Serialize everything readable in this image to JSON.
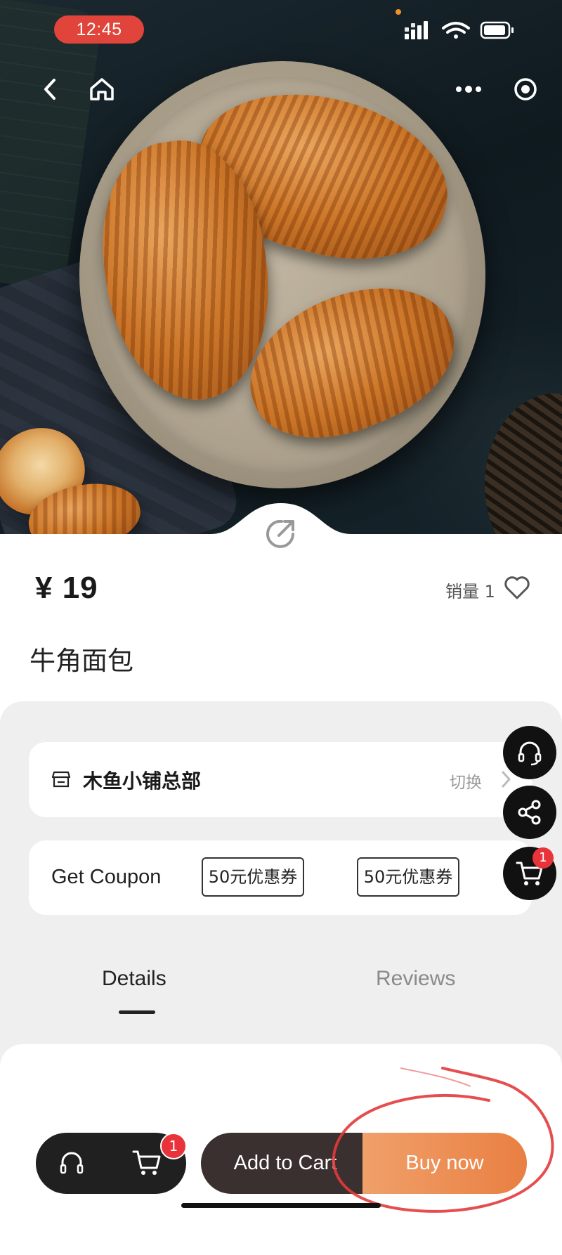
{
  "status_bar": {
    "time": "12:45"
  },
  "nav": {
    "back_icon": "chevron-left-icon",
    "home_icon": "home-icon",
    "more_icon": "more-dots-icon",
    "close_icon": "target-circle-icon"
  },
  "product": {
    "price": "¥ 19",
    "sales_label": "销量 1",
    "name": "牛角面包"
  },
  "store": {
    "name": "木鱼小铺总部",
    "switch_label": "切换"
  },
  "coupon": {
    "label": "Get Coupon",
    "tags": [
      "50元优惠券",
      "50元优惠券"
    ]
  },
  "tabs": [
    {
      "label": "Details",
      "active": true
    },
    {
      "label": "Reviews",
      "active": false
    }
  ],
  "floating": {
    "cart_count": "1"
  },
  "bottom_bar": {
    "cart_count": "1",
    "add_to_cart": "Add to Cart",
    "buy_now": "Buy now"
  },
  "colors": {
    "accent_orange": "#e97f42",
    "time_pill": "#e0443a",
    "badge_red": "#e8333a",
    "annotation_red": "#e23b3b"
  }
}
